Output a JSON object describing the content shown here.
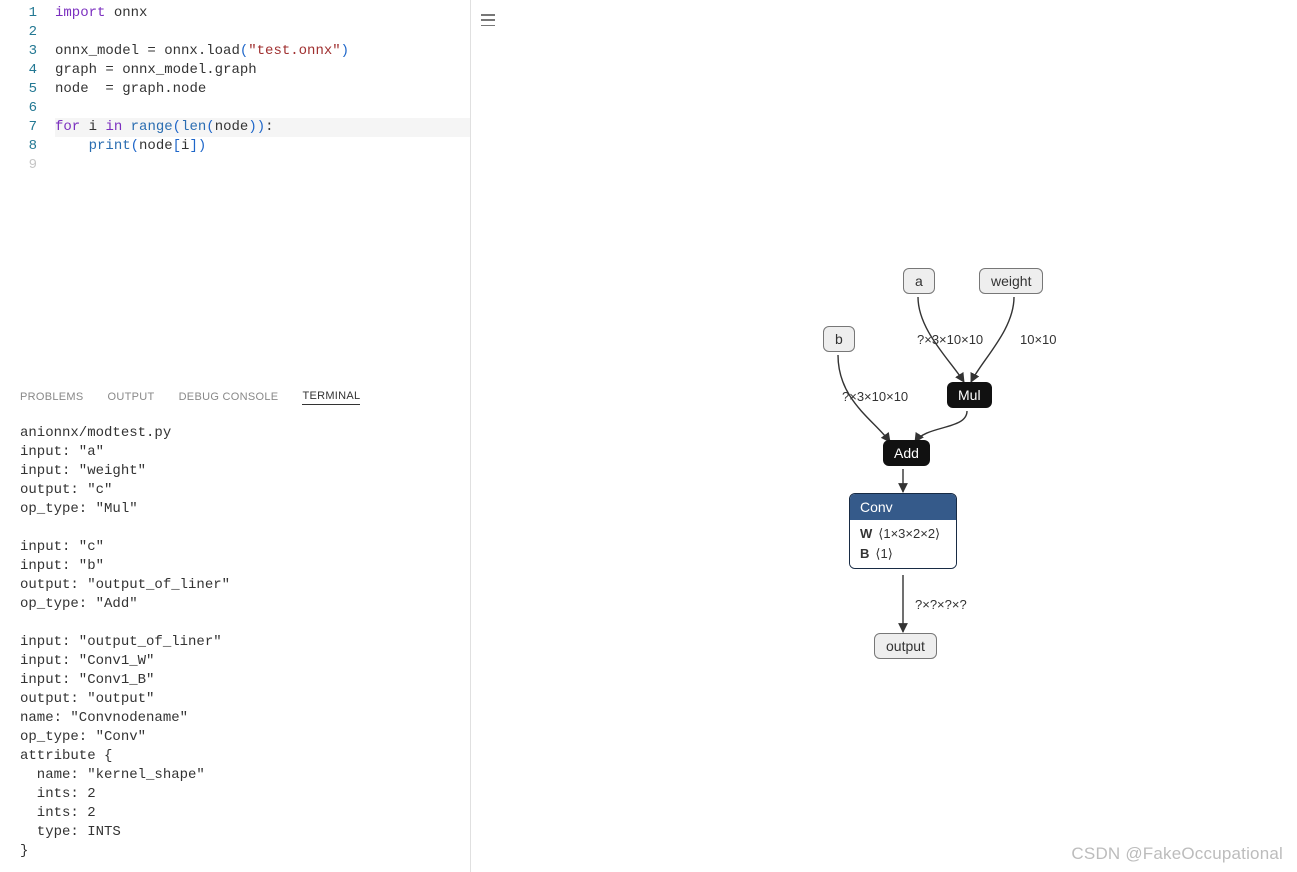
{
  "editor": {
    "lines": [
      {
        "num": "1",
        "segments": [
          {
            "t": "import",
            "c": "kw"
          },
          {
            "t": " onnx",
            "c": "plain"
          }
        ]
      },
      {
        "num": "2",
        "segments": []
      },
      {
        "num": "3",
        "segments": [
          {
            "t": "onnx_model ",
            "c": "plain"
          },
          {
            "t": "=",
            "c": "op"
          },
          {
            "t": " onnx.load",
            "c": "plain"
          },
          {
            "t": "(",
            "c": "paren"
          },
          {
            "t": "\"test.onnx\"",
            "c": "str"
          },
          {
            "t": ")",
            "c": "paren"
          }
        ]
      },
      {
        "num": "4",
        "segments": [
          {
            "t": "graph ",
            "c": "plain"
          },
          {
            "t": "=",
            "c": "op"
          },
          {
            "t": " onnx_model.graph",
            "c": "plain"
          }
        ]
      },
      {
        "num": "5",
        "segments": [
          {
            "t": "node  ",
            "c": "plain"
          },
          {
            "t": "=",
            "c": "op"
          },
          {
            "t": " graph.node",
            "c": "plain"
          }
        ]
      },
      {
        "num": "6",
        "segments": []
      },
      {
        "num": "7",
        "hl": true,
        "segments": [
          {
            "t": "for",
            "c": "kw"
          },
          {
            "t": " i ",
            "c": "plain"
          },
          {
            "t": "in",
            "c": "kw"
          },
          {
            "t": " ",
            "c": "plain"
          },
          {
            "t": "range",
            "c": "fn"
          },
          {
            "t": "(",
            "c": "paren"
          },
          {
            "t": "len",
            "c": "fn"
          },
          {
            "t": "(",
            "c": "paren"
          },
          {
            "t": "node",
            "c": "plain"
          },
          {
            "t": "))",
            "c": "paren"
          },
          {
            "t": ":",
            "c": "plain"
          }
        ]
      },
      {
        "num": "8",
        "segments": [
          {
            "t": "    ",
            "c": "plain"
          },
          {
            "t": "print",
            "c": "fn"
          },
          {
            "t": "(",
            "c": "paren"
          },
          {
            "t": "node",
            "c": "plain"
          },
          {
            "t": "[",
            "c": "paren"
          },
          {
            "t": "i",
            "c": "plain"
          },
          {
            "t": "])",
            "c": "paren"
          }
        ]
      },
      {
        "num": "9",
        "dim": true,
        "segments": []
      }
    ]
  },
  "panel": {
    "tabs": {
      "problems": "PROBLEMS",
      "output": "OUTPUT",
      "debug": "DEBUG CONSOLE",
      "terminal": "TERMINAL"
    }
  },
  "terminal": {
    "output": "anionnx/modtest.py\ninput: \"a\"\ninput: \"weight\"\noutput: \"c\"\nop_type: \"Mul\"\n\ninput: \"c\"\ninput: \"b\"\noutput: \"output_of_liner\"\nop_type: \"Add\"\n\ninput: \"output_of_liner\"\ninput: \"Conv1_W\"\ninput: \"Conv1_B\"\noutput: \"output\"\nname: \"Convnodename\"\nop_type: \"Conv\"\nattribute {\n  name: \"kernel_shape\"\n  ints: 2\n  ints: 2\n  type: INTS\n}"
  },
  "graph": {
    "nodes": {
      "a": "a",
      "weight": "weight",
      "b": "b",
      "mul": "Mul",
      "add": "Add",
      "conv_header": "Conv",
      "conv_w_label": "W",
      "conv_w_val": "⟨1×3×2×2⟩",
      "conv_b_label": "B",
      "conv_b_val": "⟨1⟩",
      "output": "output"
    },
    "edge_labels": {
      "a_mul": "?×3×10×10",
      "weight_mul": "10×10",
      "b_add": "?×3×10×10",
      "conv_out": "?×?×?×?"
    }
  },
  "watermark": "CSDN @FakeOccupational"
}
